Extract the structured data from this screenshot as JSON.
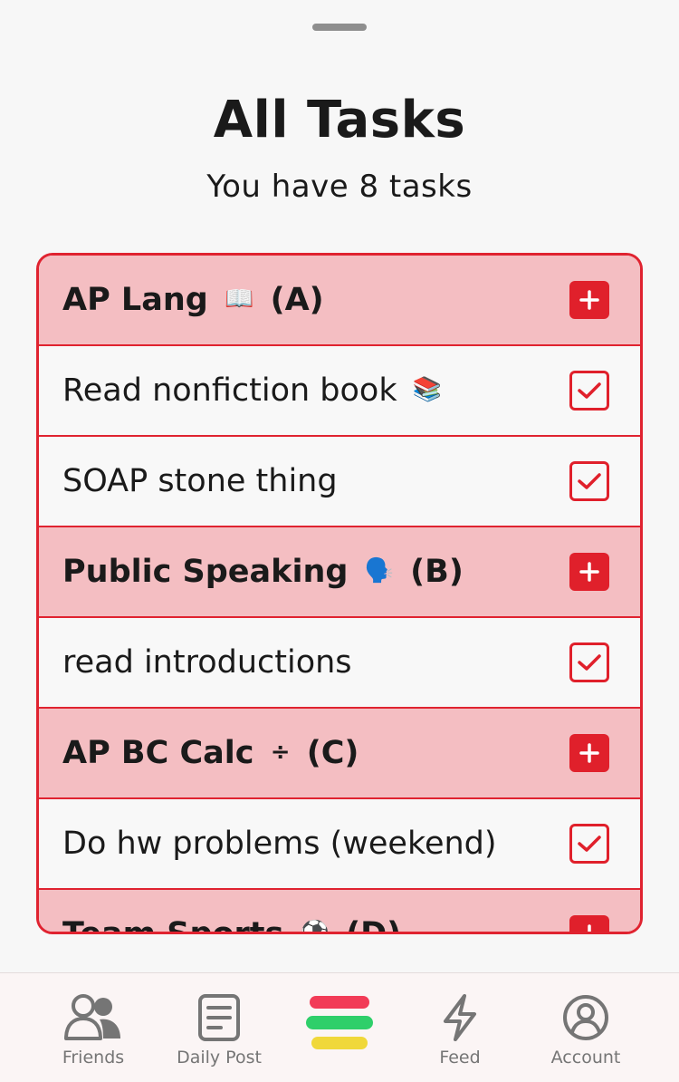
{
  "sheet": {
    "title": "All Tasks",
    "subtitle": "You have 8 tasks"
  },
  "rows": [
    {
      "type": "class",
      "text": "AP Lang",
      "emoji": "📖",
      "suffix": "(A)",
      "action": "add"
    },
    {
      "type": "task",
      "text": "Read nonfiction book",
      "emoji": "📚",
      "suffix": "",
      "action": "check"
    },
    {
      "type": "task",
      "text": "SOAP stone thing",
      "emoji": "",
      "suffix": "",
      "action": "check"
    },
    {
      "type": "class",
      "text": "Public Speaking",
      "emoji": "🗣️",
      "suffix": "(B)",
      "action": "add"
    },
    {
      "type": "task",
      "text": "read introductions",
      "emoji": "",
      "suffix": "",
      "action": "check"
    },
    {
      "type": "class",
      "text": "AP BC Calc",
      "emoji": "÷",
      "suffix": "(C)",
      "action": "add"
    },
    {
      "type": "task",
      "text": "Do hw problems (weekend)",
      "emoji": "",
      "suffix": "",
      "action": "check"
    },
    {
      "type": "class",
      "text": "Team Sports",
      "emoji": "⚽",
      "suffix": "(D)",
      "action": "add"
    }
  ],
  "tabbar": {
    "tabs": [
      {
        "label": "Friends",
        "icon": "friends-icon"
      },
      {
        "label": "Daily Post",
        "icon": "daily-post-icon"
      },
      {
        "label": "",
        "icon": "tasks-stripes-icon"
      },
      {
        "label": "Feed",
        "icon": "lightning-icon"
      },
      {
        "label": "Account",
        "icon": "account-icon"
      }
    ]
  },
  "colors": {
    "accent": "#e0202b",
    "header_row": "#f4bec2",
    "stripe_red": "#f23b57",
    "stripe_green": "#2fcf6a",
    "stripe_yellow": "#f0d83a"
  }
}
